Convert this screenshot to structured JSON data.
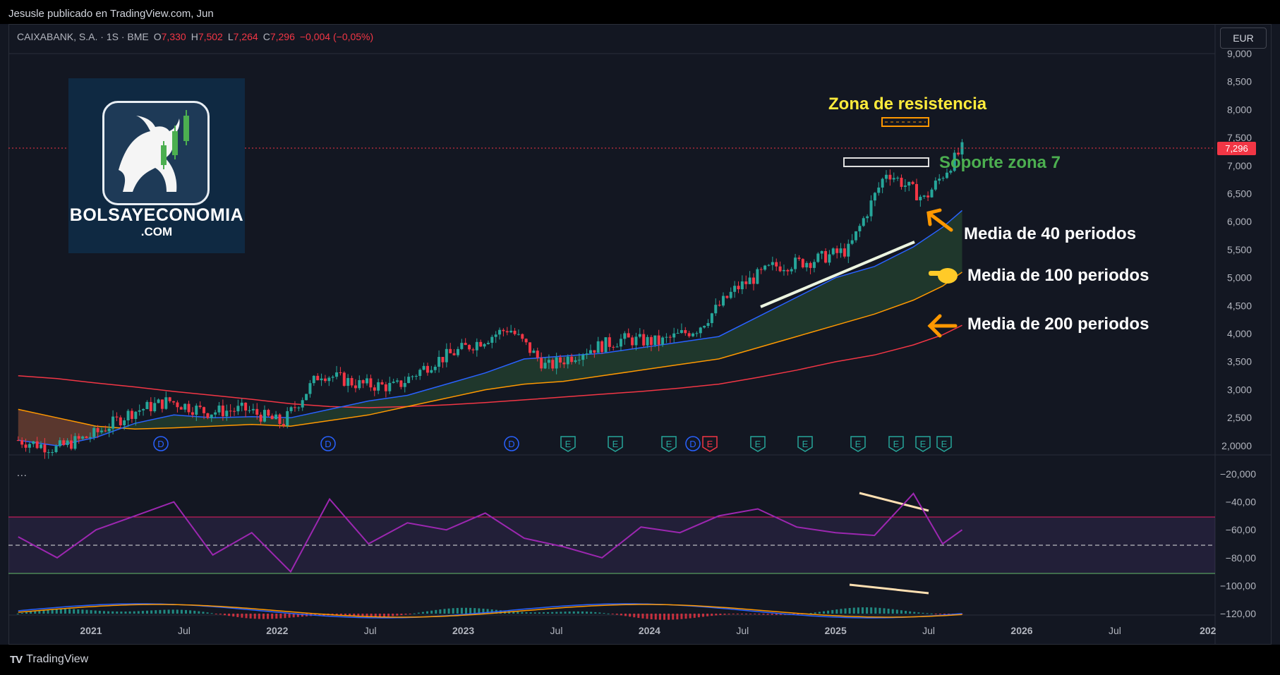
{
  "header": {
    "publisher": "Jesusle publicado en TradingView.com, Jun"
  },
  "legend": {
    "symbol": "CAIXABANK, S.A.",
    "interval": "1S",
    "exchange": "BME",
    "open_label": "O",
    "open": "7,330",
    "high_label": "H",
    "high": "7,502",
    "low_label": "L",
    "low": "7,264",
    "close_label": "C",
    "close": "7,296",
    "change": "−0,004 (−0,05%)"
  },
  "currency_button": "EUR",
  "last_price": "7,296",
  "indicator_menu": "...",
  "footer": {
    "brand": "TradingView"
  },
  "watermark": {
    "name": "BOLSAYECONOMIA",
    "sub": ".COM"
  },
  "annotations": {
    "resistance": "Zona de resistencia",
    "support": "Soporte zona 7",
    "ma40": "Media de 40 periodos",
    "ma100": "Media de 100 periodos",
    "ma200": "Media de 200 periodos"
  },
  "colors": {
    "background": "#131722",
    "up": "#26a69a",
    "down": "#f23645",
    "ma40": "#2962ff",
    "ma100": "#ff9800",
    "ma200": "#f23645",
    "oscillator": "#9c27b0",
    "annotation_yellow": "#ffeb3b",
    "annotation_green": "#4caf50",
    "arrow_orange": "#ff9800"
  },
  "chart_data": {
    "type": "line",
    "price_axis": {
      "ticks": [
        "9,000",
        "8,500",
        "8,000",
        "7,500",
        "7,000",
        "6,500",
        "6,000",
        "5,500",
        "5,000",
        "4,500",
        "4,000",
        "3,500",
        "3,000",
        "2,500",
        "2,0000"
      ],
      "ylim": [
        2.0,
        9.0
      ]
    },
    "oscillator_axis": {
      "ticks": [
        "−20,000",
        "−40,00",
        "−60,00",
        "−80,00",
        "−100,00",
        "−120,00"
      ]
    },
    "time_axis": {
      "ticks": [
        "2021",
        "Jul",
        "2022",
        "Jul",
        "2023",
        "Jul",
        "2024",
        "Jul",
        "2025",
        "Jul",
        "2026",
        "Jul",
        "202"
      ]
    },
    "x": [
      2020.6,
      2020.8,
      2021.0,
      2021.2,
      2021.4,
      2021.6,
      2021.8,
      2022.0,
      2022.2,
      2022.4,
      2022.6,
      2022.8,
      2023.0,
      2023.2,
      2023.4,
      2023.6,
      2023.8,
      2024.0,
      2024.2,
      2024.4,
      2024.6,
      2024.8,
      2025.0,
      2025.2,
      2025.35,
      2025.45
    ],
    "series": [
      {
        "name": "",
        "values": [
          2.1,
          1.95,
          2.2,
          2.6,
          2.8,
          2.6,
          2.65,
          2.4,
          3.3,
          3.1,
          3.05,
          3.5,
          3.8,
          4.1,
          3.4,
          3.7,
          3.9,
          3.85,
          4.1,
          4.8,
          5.2,
          5.3,
          5.5,
          6.9,
          6.4,
          7.296
        ]
      },
      {
        "name": "Media de 40 periodos",
        "values": [
          2.1,
          2.0,
          2.15,
          2.4,
          2.55,
          2.5,
          2.52,
          2.5,
          2.65,
          2.8,
          2.9,
          3.1,
          3.3,
          3.55,
          3.6,
          3.65,
          3.75,
          3.85,
          3.95,
          4.3,
          4.65,
          5.0,
          5.2,
          5.55,
          5.9,
          6.2
        ]
      },
      {
        "name": "Media de 100 periodos",
        "values": [
          2.65,
          2.5,
          2.35,
          2.3,
          2.32,
          2.35,
          2.38,
          2.35,
          2.45,
          2.55,
          2.7,
          2.85,
          3.0,
          3.1,
          3.15,
          3.25,
          3.35,
          3.45,
          3.55,
          3.75,
          3.95,
          4.15,
          4.35,
          4.6,
          4.85,
          5.1
        ]
      },
      {
        "name": "Media de 200 periodos",
        "values": [
          3.25,
          3.2,
          3.12,
          3.05,
          2.97,
          2.9,
          2.83,
          2.75,
          2.7,
          2.68,
          2.7,
          2.73,
          2.77,
          2.82,
          2.87,
          2.92,
          2.97,
          3.03,
          3.1,
          3.22,
          3.35,
          3.5,
          3.62,
          3.8,
          3.98,
          4.15
        ]
      }
    ],
    "oscillator": {
      "values": [
        -65,
        -80,
        -60,
        -50,
        -40,
        -78,
        -62,
        -90,
        -38,
        -70,
        -55,
        -60,
        -48,
        -66,
        -72,
        -80,
        -58,
        -62,
        -50,
        -45,
        -58,
        -62,
        -64,
        -34,
        -70,
        -60
      ]
    },
    "events": [
      "D",
      "D",
      "D",
      "E",
      "E",
      "E",
      "D",
      "E",
      "E",
      "E",
      "E",
      "E",
      "E",
      "E"
    ],
    "resistance_zone": [
      7.6,
      7.75
    ],
    "support_zone": [
      6.95,
      7.1
    ]
  }
}
